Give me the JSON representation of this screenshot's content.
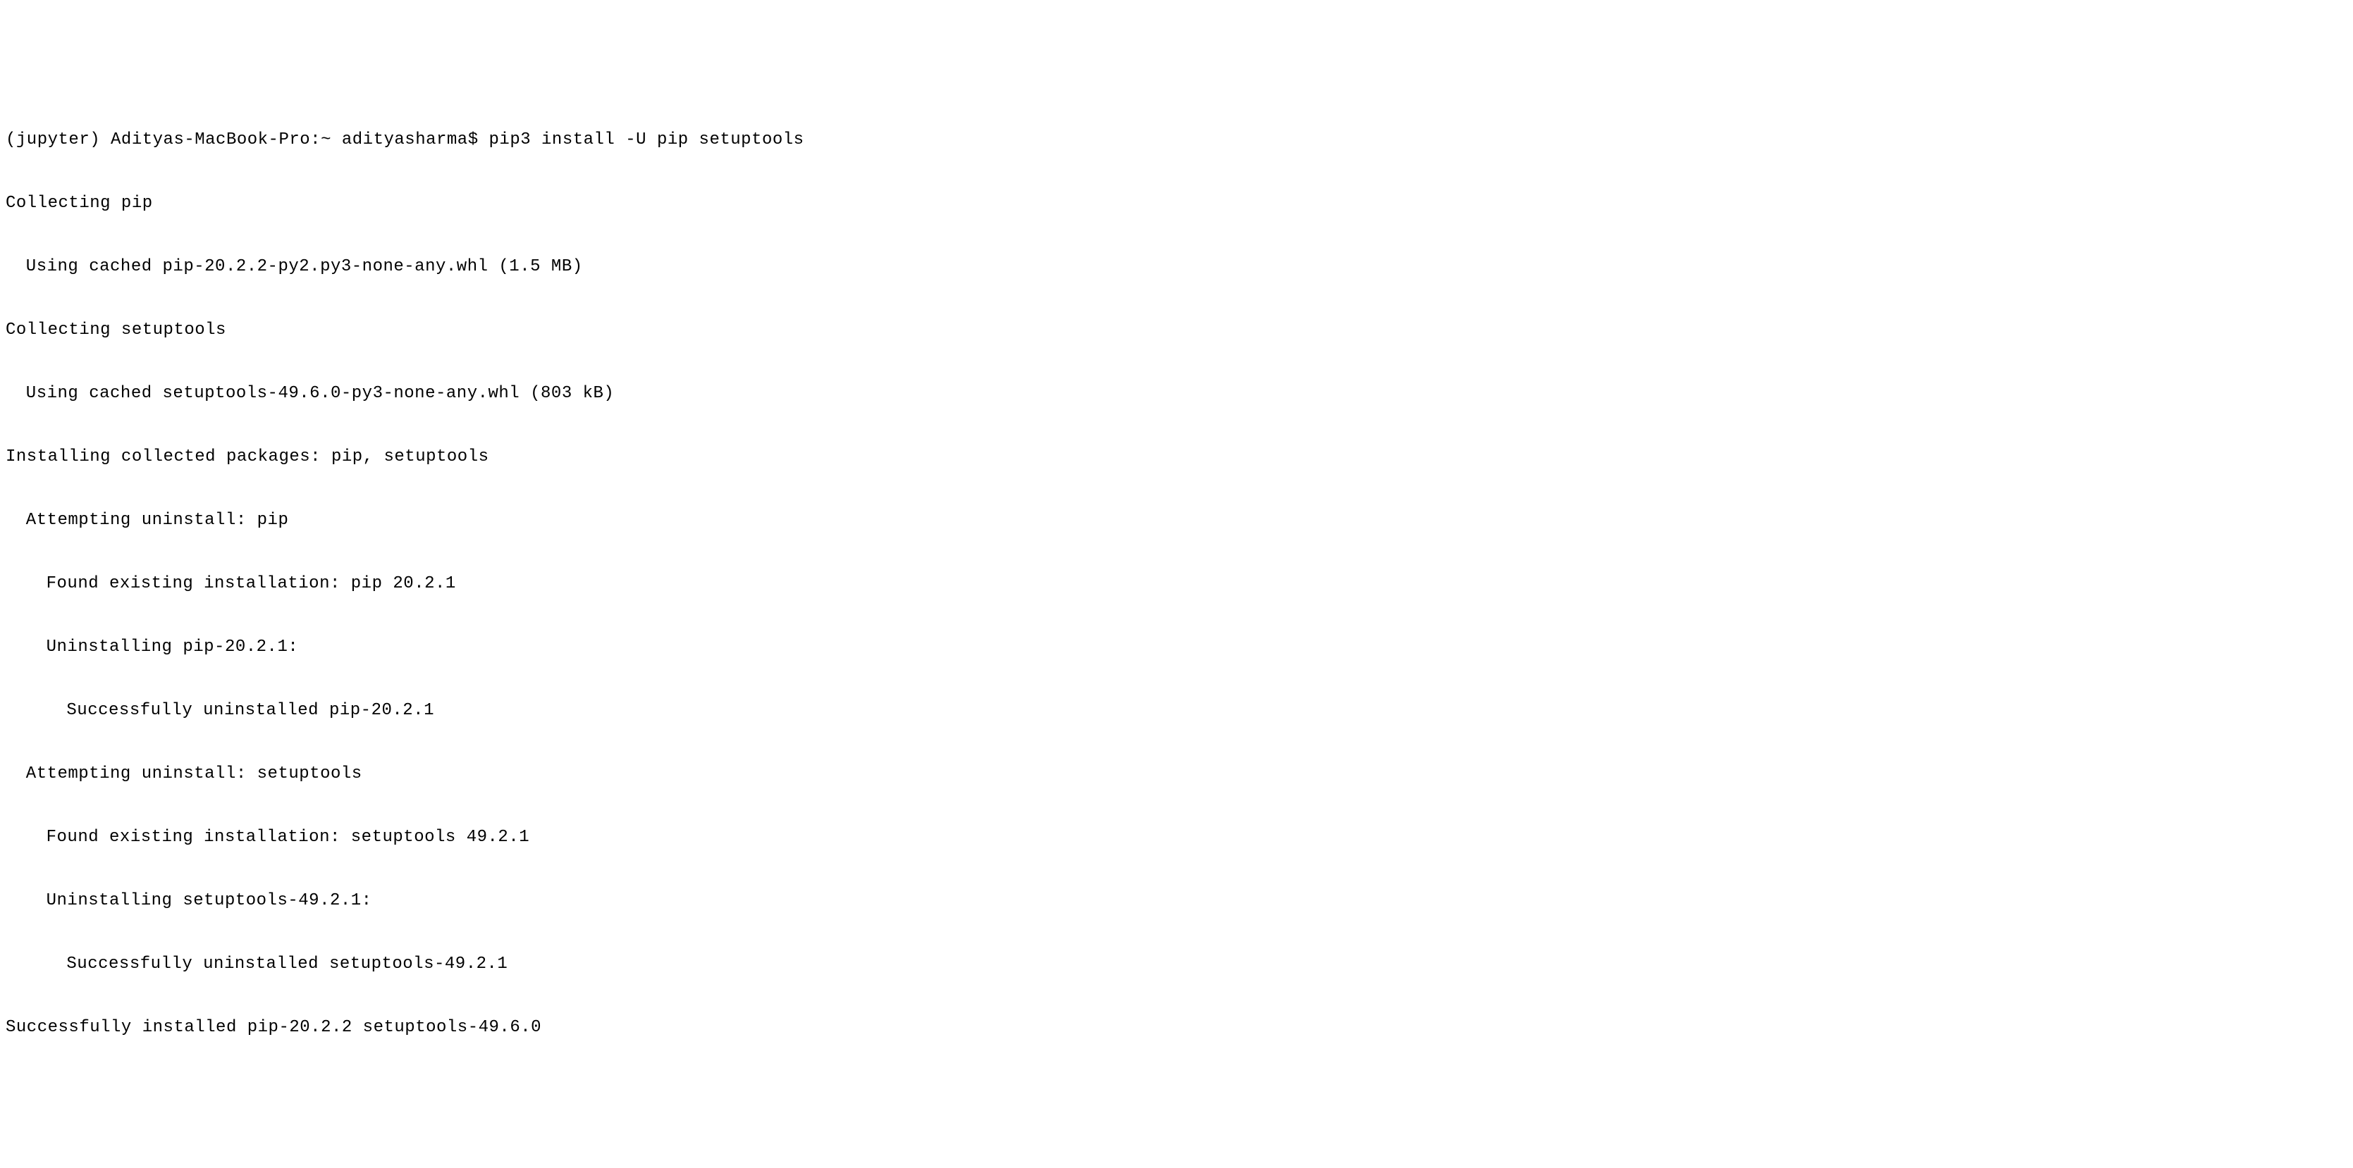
{
  "terminal": {
    "prompt_env": "(jupyter)",
    "prompt_host": "Adityas-MacBook-Pro:~",
    "prompt_user": "adityasharma$",
    "command": "pip3 install -U pip setuptools",
    "lines": {
      "l0": "(jupyter) Adityas-MacBook-Pro:~ adityasharma$ pip3 install -U pip setuptools",
      "l1": "Collecting pip",
      "l2": "Using cached pip-20.2.2-py2.py3-none-any.whl (1.5 MB)",
      "l3": "Collecting setuptools",
      "l4": "Using cached setuptools-49.6.0-py3-none-any.whl (803 kB)",
      "l5": "Installing collected packages: pip, setuptools",
      "l6": "Attempting uninstall: pip",
      "l7": "Found existing installation: pip 20.2.1",
      "l8": "Uninstalling pip-20.2.1:",
      "l9": "Successfully uninstalled pip-20.2.1",
      "l10": "Attempting uninstall: setuptools",
      "l11": "Found existing installation: setuptools 49.2.1",
      "l12": "Uninstalling setuptools-49.2.1:",
      "l13": "Successfully uninstalled setuptools-49.2.1",
      "l14": "Successfully installed pip-20.2.2 setuptools-49.6.0"
    }
  }
}
